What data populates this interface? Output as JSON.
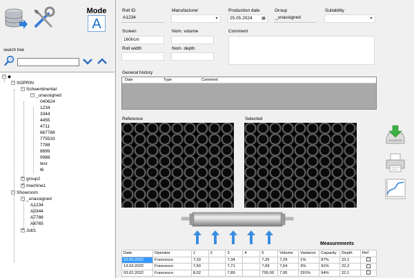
{
  "toolbar": {
    "mode_label": "Mode",
    "mode_letter": "A"
  },
  "search": {
    "label": "search tree",
    "value": "",
    "placeholder": ""
  },
  "tree": {
    "root": "SOPRIN",
    "sites": [
      {
        "name": "Schwentinental",
        "groups": [
          {
            "name": "_unassigned",
            "items": [
              "040624",
              "1234",
              "3344",
              "4455",
              "4711",
              "667788",
              "775533",
              "7788",
              "8899",
              "9988",
              "test",
              "t6"
            ]
          },
          {
            "name": "group2",
            "items": []
          },
          {
            "name": "machine1",
            "items": []
          }
        ]
      },
      {
        "name": "Showroom",
        "groups": [
          {
            "name": "_unassigned",
            "items": [
              "A1234",
              "A3344",
              "A7788",
              "A8765"
            ]
          },
          {
            "name": "Job1",
            "items": []
          }
        ]
      }
    ]
  },
  "form": {
    "roll_id_label": "Roll ID",
    "roll_id": "A1234",
    "manufacturer_label": "Manufacturer",
    "manufacturer": "",
    "production_date_label": "Production date",
    "production_date": "25.05.2024",
    "group_label": "Group",
    "group": "_unassigned",
    "suitability_label": "Suitability",
    "suitability": "",
    "screen_label": "Screen",
    "screen": "160l/cm",
    "nom_volume_label": "Nom. volume",
    "nom_volume": "",
    "comment_label": "Comment",
    "comment": "",
    "roll_width_label": "Roll width",
    "roll_width": "",
    "nom_depth_label": "Nom. depth",
    "nom_depth": ""
  },
  "history": {
    "title": "General history",
    "columns": [
      "Date",
      "Type",
      "Comment"
    ]
  },
  "images": {
    "reference_label": "Reference",
    "selected_label": "Selected"
  },
  "measurements": {
    "title": "Measurements",
    "columns": [
      "Date",
      "Operator",
      "1",
      "2",
      "3",
      "4",
      "5",
      "Volume",
      "Variance",
      "Capacity",
      "Depth",
      "Ref"
    ],
    "rows": [
      [
        "23.05.2022",
        "Francesco",
        "7,33",
        "",
        "7,34",
        "",
        "7,25",
        "7,29",
        "1%",
        "87%",
        "22,1",
        ""
      ],
      [
        "13.03.2022",
        "Francesco",
        "7,50",
        "",
        "7,71",
        "",
        "7,69",
        "7,64",
        "3%",
        "91%",
        "22,2",
        ""
      ],
      [
        "03.02.2022",
        "Francesco",
        "8,02",
        "",
        "7,89",
        "",
        "795,00",
        "7,95",
        "291%",
        "94%",
        "22,1",
        ""
      ]
    ]
  },
  "colors": {
    "selection": "#3399ff",
    "accent_arrow": "#3a8de0",
    "mode_letter": "#1e6fd0"
  },
  "icons": [
    "database-export-icon",
    "tools-icon",
    "mode-a-icon",
    "search-icon",
    "chevron-down-icon",
    "chevron-up-icon",
    "save-icon",
    "print-icon",
    "chart-icon"
  ]
}
